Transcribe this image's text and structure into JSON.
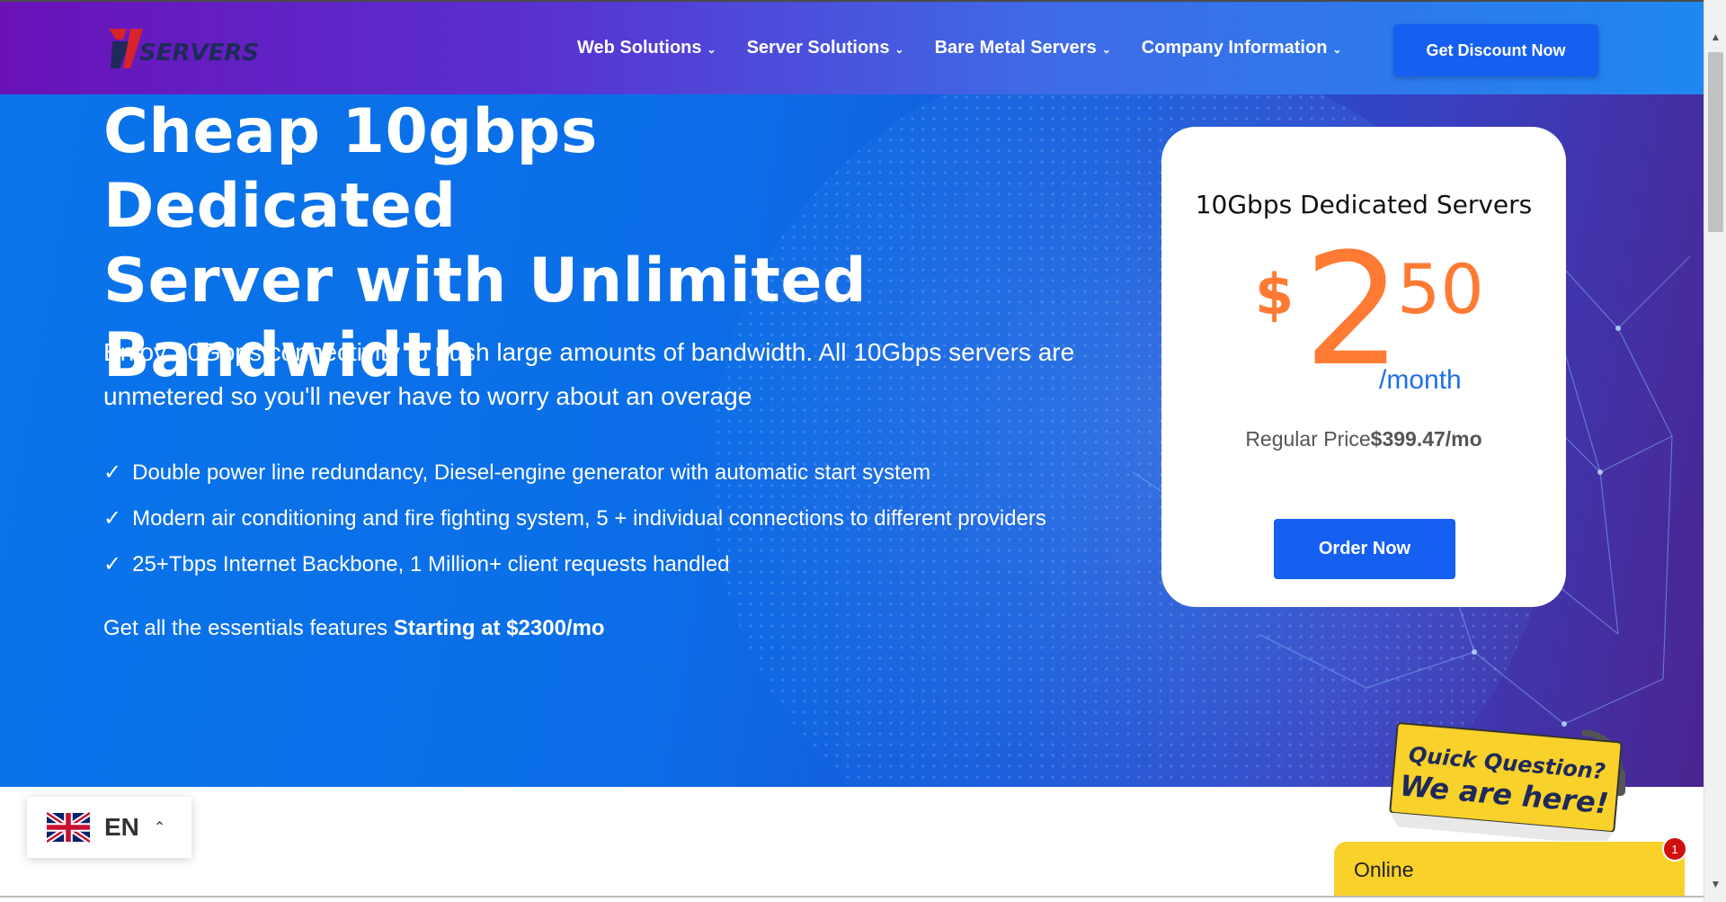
{
  "header": {
    "logo_text": "SERVERS",
    "nav": [
      {
        "label": "Web Solutions"
      },
      {
        "label": "Server Solutions"
      },
      {
        "label": "Bare Metal Servers"
      },
      {
        "label": "Company Information"
      }
    ],
    "cta_label": "Get Discount Now"
  },
  "hero": {
    "title_lines": [
      "Cheap 10gbps Dedicated",
      "Server with Unlimited",
      "Bandwidth"
    ],
    "subtitle": "Enjoy 10Gbps connectivity to push large amounts of bandwidth. All 10Gbps servers are unmetered so you'll never have to worry about an overage",
    "features": [
      "Double power line redundancy, Diesel-engine generator with automatic start system",
      "Modern air conditioning and fire fighting system, 5 + individual connections to different providers",
      "25+Tbps Internet Backbone, 1 Million+ client requests handled"
    ],
    "essentials_prefix": "Get all the essentials features ",
    "essentials_bold": "Starting at $2300/mo"
  },
  "card": {
    "title": "10Gbps Dedicated Servers",
    "currency": "$",
    "price_main": "2",
    "price_cents": "50",
    "period": "/month",
    "regular_label": "Regular Price",
    "regular_value": "$399.47/mo",
    "order_label": "Order Now"
  },
  "language": {
    "code": "EN"
  },
  "chat": {
    "badge_line1": "Quick Question?",
    "badge_line2": "We are here!",
    "status": "Online",
    "notification_count": "1"
  },
  "colors": {
    "accent_blue": "#1560f0",
    "price_orange": "#ff7a33",
    "chat_yellow": "#f8d12a"
  }
}
